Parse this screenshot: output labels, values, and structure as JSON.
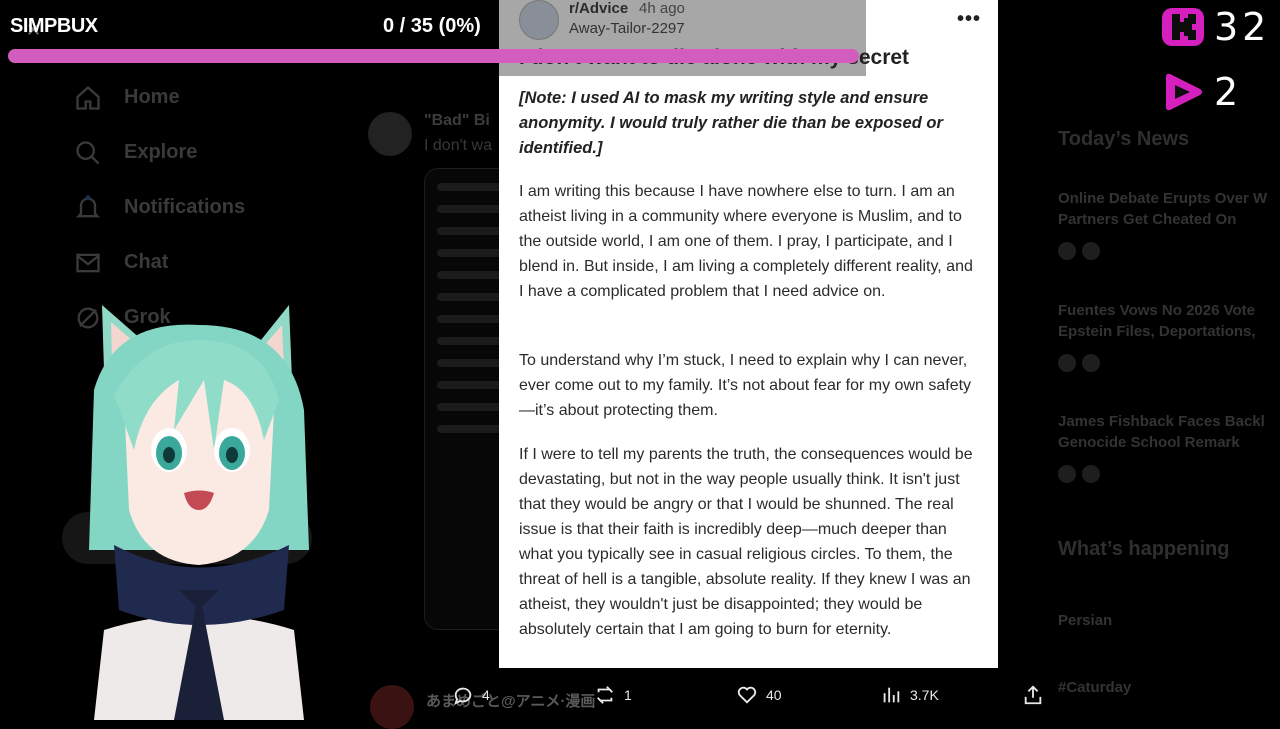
{
  "overlay": {
    "brand": "SIMPBUX",
    "progress_text": "0 / 35 (0%)",
    "progress_fraction": 0,
    "bar_color": "#d25dbf",
    "stat_kick_value": "32",
    "stat_twitch_value": "2",
    "kick_color": "#d61fbf",
    "twitch_color": "#d61fbf"
  },
  "sidebar": {
    "items": [
      {
        "label": "Home",
        "icon": "home-icon"
      },
      {
        "label": "Explore",
        "icon": "search-icon"
      },
      {
        "label": "Notifications",
        "icon": "bell-icon"
      },
      {
        "label": "Chat",
        "icon": "mail-icon"
      },
      {
        "label": "Grok",
        "icon": "grok-icon"
      }
    ]
  },
  "feed": {
    "title_fragment": "\"Bad\" Bi",
    "line_fragment": "I don't wa",
    "next_author": "あまめごと@アニメ·漫画"
  },
  "post": {
    "subreddit": "r/Advice",
    "time": "4h ago",
    "username": "Away-Tailor-2297",
    "title": "I don't want to die alone with my secret",
    "note": "[Note: I used AI to mask my writing style and ensure anonymity. I would truly rather die than be exposed or identified.]",
    "paragraphs": [
      "I am writing this because I have nowhere else to turn. I am an atheist living in a community where everyone is Muslim, and to the outside world, I am one of them. I pray, I participate, and I blend in. But inside, I am living a completely different reality, and I have a complicated problem that I need advice on.",
      "To understand why I’m stuck, I need to explain why I can never, ever come out to my family. It’s not about fear for my own safety—it’s about protecting them.",
      "If I were to tell my parents the truth, the consequences would be devastating, but not in the way people usually think. It isn't just that they would be angry or that I would be shunned. The real issue is that their faith is incredibly deep—much deeper than what you typically see in casual religious circles. To them, the threat of hell is a tangible, absolute reality. If they knew I was an atheist, they wouldn't just be disappointed; they would be absolutely certain that I am going to burn for eternity."
    ]
  },
  "actions": {
    "replies": "4",
    "reposts": "1",
    "likes": "40",
    "views": "3.7K"
  },
  "right": {
    "todays_news": "Today’s News",
    "news": [
      {
        "title_line1": "Online Debate Erupts Over W",
        "title_line2": "Partners Get Cheated On"
      },
      {
        "title_line1": "Fuentes Vows No 2026 Vote",
        "title_line2": "Epstein Files, Deportations,"
      },
      {
        "title_line1": "James Fishback Faces Backl",
        "title_line2": "Genocide School Remark"
      }
    ],
    "whats_happening": "What’s happening",
    "trend_name": "Persian",
    "trend_tag": "#Caturday"
  }
}
